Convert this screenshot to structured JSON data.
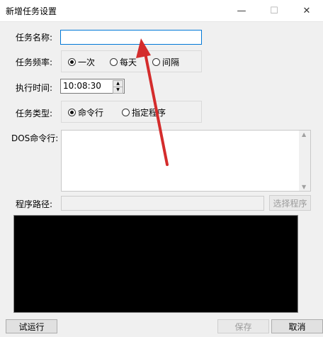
{
  "window": {
    "title": "新增任务设置",
    "minimize_glyph": "—",
    "maximize_glyph": "☐",
    "close_glyph": "✕"
  },
  "form": {
    "task_name_label": "任务名称:",
    "task_name_value": "",
    "frequency_label": "任务频率:",
    "frequency_options": [
      {
        "label": "一次",
        "selected": true
      },
      {
        "label": "每天",
        "selected": false
      },
      {
        "label": "间隔",
        "selected": false
      }
    ],
    "exec_time_label": "执行时间:",
    "exec_time_value": "10:08:30",
    "task_type_label": "任务类型:",
    "task_type_options": [
      {
        "label": "命令行",
        "selected": true
      },
      {
        "label": "指定程序",
        "selected": false
      }
    ],
    "dos_label": "DOS命令行:",
    "dos_value": "",
    "program_path_label": "程序路径:",
    "program_path_value": "",
    "select_program_label": "选择程序"
  },
  "footer": {
    "test_run_label": "试运行",
    "save_label": "保存",
    "cancel_label": "取消"
  },
  "colors": {
    "accent_border": "#0078d7",
    "console_bg": "#000000",
    "arrow": "#d42c2c"
  }
}
